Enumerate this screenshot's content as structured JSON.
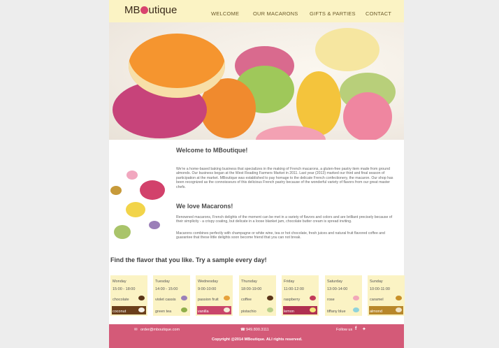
{
  "header": {
    "logo_prefix": "MB",
    "logo_suffix": "utique",
    "nav": [
      "WELCOME",
      "OUR MACARONS",
      "GIFTS & PARTIES",
      "CONTACT"
    ]
  },
  "welcome": {
    "title": "Welcome to MBoutique!",
    "body": "We're a home-based baking business that specializes in the making of French macarons, a gluten-free pastry item made from ground almonds. Our business began at the West Reading Farmers Market in 2011. Last year (2013) marked our third and final season of participation at the market. MBoutique was established to pay homage to the delicate French confectionery, the macaron. Our shop has been recognized as the connoisseurs of this delicious French pastry because of the wonderful variety of flavors from our great master chefs."
  },
  "love": {
    "title": "We love Macarons!",
    "body1": "Renowned macarons, French delights of the moment can be met in a variety of flavors and colors and are brilliant precisely because of their simplicity - a crispy coating, but delicate in a loose blanket jam, chocolate butter cream is spread inviting.",
    "body2": "Macarons combines perfectly with champagne or white wine, tea or hot chocolate, fresh juices and natural fruit flavored coffee and guarantee that these little delights soon become friend that you can not break."
  },
  "schedule": {
    "title": "Find the flavor that you like. Try a sample every day!",
    "days": [
      {
        "name": "Monday",
        "time": "15:00 - 18:00",
        "flavor1": "chocolate",
        "flavor2": "coconut",
        "c1": "#5a3418",
        "c2": "#6b3f1a",
        "swatch": "#6b3f1a",
        "m2": "#f4efe6"
      },
      {
        "name": "Tuesday",
        "time": "14:00 - 15:00",
        "flavor1": "violet cassis",
        "flavor2": "green tea",
        "c1": "#9b7fb8",
        "c2": "#8fae4a",
        "swatch": "#fbf3c4",
        "m2": "#8fae4a"
      },
      {
        "name": "Wednesday",
        "time": "9:00-10:00",
        "flavor1": "passion fruit",
        "flavor2": "vanilla",
        "c1": "#e6a13c",
        "c2": "#f3ecd8",
        "swatch": "#c9466a",
        "m2": "#f3ecd8"
      },
      {
        "name": "Thursday",
        "time": "18:00-19:00",
        "flavor1": "coffee",
        "flavor2": "pistachio",
        "c1": "#5a3418",
        "c2": "#b8cf8a",
        "swatch": "#fbf3c4",
        "m2": "#b8cf8a"
      },
      {
        "name": "Friday",
        "time": "11:00-12:00",
        "flavor1": "raspberry",
        "flavor2": "lemon",
        "c1": "#c23a5a",
        "c2": "#f4e37a",
        "swatch": "#b03050",
        "m2": "#f4e37a"
      },
      {
        "name": "Saturday",
        "time": "13:00-14:00",
        "flavor1": "rose",
        "flavor2": "tiffany blue",
        "c1": "#f2a7b9",
        "c2": "#8fd3dc",
        "swatch": "#fbf3c4",
        "m2": "#8fd3dc"
      },
      {
        "name": "Sunday",
        "time": "10:00-11:00",
        "flavor1": "caramel",
        "flavor2": "almond",
        "c1": "#c89028",
        "c2": "#efe2c4",
        "swatch": "#b8872a",
        "m2": "#efe2c4"
      }
    ]
  },
  "footer": {
    "email": "order@mboutique.com",
    "phone": "949.800.3111",
    "follow": "Follow us",
    "copyright": "Copyright @2014 MBoutique. ALl rights reserved."
  },
  "colors": {
    "header_bg": "#fbf3c4",
    "footer_bg": "#d45a78",
    "accent": "#d8436e"
  }
}
